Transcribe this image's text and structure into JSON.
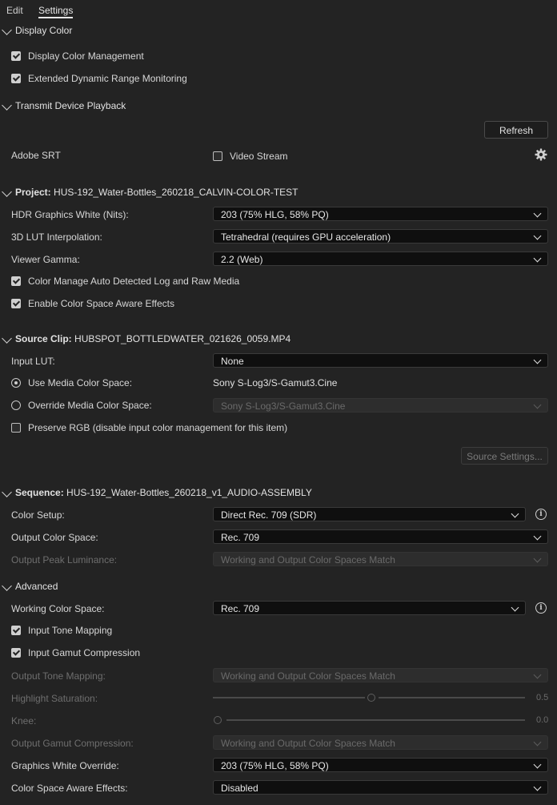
{
  "tabs": [
    {
      "label": "Edit"
    },
    {
      "label": "Settings"
    }
  ],
  "display_color": {
    "title": "Display Color",
    "options": [
      {
        "label": "Display Color Management",
        "checked": true
      },
      {
        "label": "Extended Dynamic Range Monitoring",
        "checked": true
      }
    ]
  },
  "transmit": {
    "title": "Transmit Device Playback",
    "refresh_label": "Refresh",
    "device_label": "Adobe SRT",
    "video_stream_label": "Video Stream",
    "settings_icon": "gear-icon"
  },
  "project": {
    "prefix": "Project:",
    "name": "HUS-192_Water-Bottles_260218_CALVIN-COLOR-TEST",
    "hdr_label": "HDR Graphics White (Nits):",
    "hdr_value": "203 (75% HLG, 58% PQ)",
    "lut_label": "3D LUT Interpolation:",
    "lut_value": "Tetrahedral (requires GPU acceleration)",
    "gamma_label": "Viewer Gamma:",
    "gamma_value": "2.2 (Web)",
    "options": [
      {
        "label": "Color Manage Auto Detected Log and Raw Media",
        "checked": true
      },
      {
        "label": "Enable Color Space Aware Effects",
        "checked": true
      }
    ]
  },
  "source": {
    "prefix": "Source Clip:",
    "name": "HUBSPOT_BOTTLEDWATER_021626_0059.MP4",
    "input_lut_label": "Input LUT:",
    "input_lut_value": "None",
    "use_media_label": "Use Media Color Space:",
    "use_media_value": "Sony S-Log3/S-Gamut3.Cine",
    "override_label": "Override Media Color Space:",
    "override_value": "Sony S-Log3/S-Gamut3.Cine",
    "preserve_label": "Preserve RGB (disable input color management for this item)",
    "source_settings_label": "Source Settings..."
  },
  "sequence": {
    "prefix": "Sequence:",
    "name": "HUS-192_Water-Bottles_260218_v1_AUDIO-ASSEMBLY",
    "color_setup_label": "Color Setup:",
    "color_setup_value": "Direct Rec. 709 (SDR)",
    "output_cs_label": "Output Color Space:",
    "output_cs_value": "Rec. 709",
    "peak_label": "Output Peak Luminance:",
    "peak_value": "Working and Output Color Spaces Match"
  },
  "advanced": {
    "title": "Advanced",
    "working_label": "Working Color Space:",
    "working_value": "Rec. 709",
    "options": [
      {
        "label": "Input Tone Mapping",
        "checked": true
      },
      {
        "label": "Input Gamut Compression",
        "checked": true
      }
    ],
    "tone_label": "Output Tone Mapping:",
    "tone_value": "Working and Output Color Spaces Match",
    "highlight_label": "Highlight Saturation:",
    "highlight_value": "0.5",
    "knee_label": "Knee:",
    "knee_value": "0.0",
    "gamut_label": "Output Gamut Compression:",
    "gamut_value": "Working and Output Color Spaces Match",
    "gw_label": "Graphics White Override:",
    "gw_value": "203 (75% HLG, 58% PQ)",
    "csae_label": "Color Space Aware Effects:",
    "csae_value": "Disabled"
  }
}
